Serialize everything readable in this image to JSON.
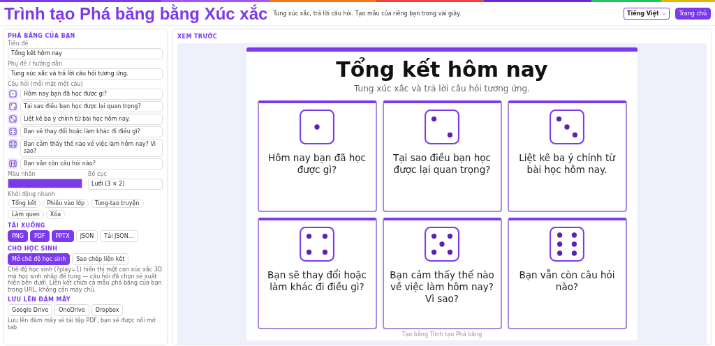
{
  "header": {
    "title": "Trình tạo Phá băng bằng Xúc xắc",
    "tagline": "Tung xúc xắc, trả lời câu hỏi. Tạo mẫu của riêng bạn trong vài giây.",
    "language": "Tiếng Việt",
    "home_button": "Trang chủ"
  },
  "editor": {
    "heading": "PHÁ BĂNG CỦA BẠN",
    "title_label": "Tiêu đề",
    "title_value": "Tổng kết hôm nay",
    "subtitle_label": "Phụ đề / hướng dẫn",
    "subtitle_value": "Tung xúc xắc và trả lời câu hỏi tương ứng.",
    "questions_label": "Câu hỏi (mỗi mặt một câu)",
    "questions": [
      "Hôm nay bạn đã học được gì?",
      "Tại sao điều bạn học được lại quan trọng?",
      "Liệt kê ba ý chính từ bài học hôm nay.",
      "Bạn sẽ thay đổi hoặc làm khác đi điều gì?",
      "Bạn cảm thấy thế nào về việc làm hôm nay? Vì sao?",
      "Bạn vẫn còn câu hỏi nào?"
    ],
    "color_label": "Màu nhấn",
    "color": "#7c3aed",
    "layout_label": "Bố cục",
    "layout_value": "Lưới (3 × 2)",
    "quick_label": "Khởi động nhanh",
    "presets": [
      "Tổng kết",
      "Phiếu vào lớp",
      "Tung-tạo truyện",
      "Làm quen",
      "Xóa"
    ]
  },
  "download": {
    "heading": "TẢI XUỐNG",
    "buttons": [
      {
        "label": "PNG",
        "primary": true
      },
      {
        "label": "PDF",
        "primary": true
      },
      {
        "label": "PPTX",
        "primary": true
      },
      {
        "label": "JSON",
        "primary": false
      },
      {
        "label": "Tải JSON…",
        "primary": false
      }
    ]
  },
  "students": {
    "heading": "CHO HỌC SINH",
    "buttons": [
      {
        "label": "Mở chế độ học sinh",
        "primary": true
      },
      {
        "label": "Sao chép liên kết",
        "primary": false
      }
    ],
    "note": "Chế độ học sinh (?play=1) hiển thị một con xúc xắc 3D mà học sinh nhấp để tung — câu hỏi đã chọn sẽ xuất hiện bên dưới. Liên kết chứa cả mẫu phá băng của bạn trong URL, không cần máy chủ."
  },
  "cloud": {
    "heading": "LƯU LÊN ĐÁM MÂY",
    "buttons": [
      "Google Drive",
      "OneDrive",
      "Dropbox"
    ],
    "note": "Lưu lên đám mây sẽ tải tệp PDF, bạn sẽ được nối mở tab"
  },
  "preview": {
    "heading": "XEM TRƯỚC",
    "title": "Tổng kết hôm nay",
    "subtitle": "Tung xúc xắc và trả lời câu hỏi tương ứng.",
    "cards": [
      "Hôm nay bạn đã học được gì?",
      "Tại sao điều bạn học được lại quan trọng?",
      "Liệt kê ba ý chính từ bài học hôm nay.",
      "Bạn sẽ thay đổi hoặc làm khác đi điều gì?",
      "Bạn cảm thấy thế nào về việc làm hôm nay? Vì sao?",
      "Bạn vẫn còn câu hỏi nào?"
    ],
    "footer": "Tạo bằng Trình tạo Phá băng"
  }
}
